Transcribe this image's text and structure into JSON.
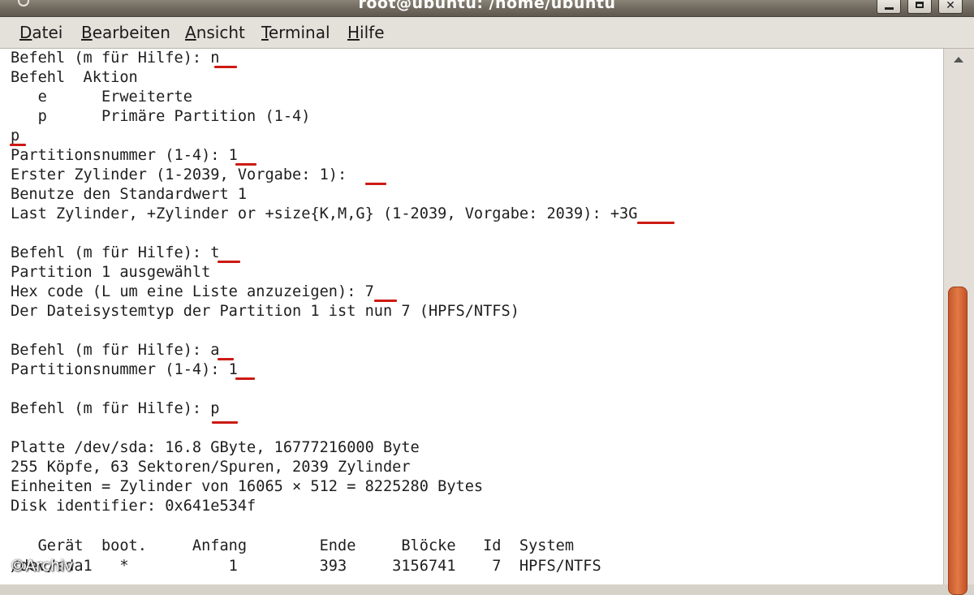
{
  "window": {
    "title": "root@ubuntu: /home/ubuntu",
    "minimize_glyph": "_",
    "maximize_glyph": "□",
    "close_glyph": "✕"
  },
  "menu": {
    "items": [
      "Datei",
      "Bearbeiten",
      "Ansicht",
      "Terminal",
      "Hilfe"
    ]
  },
  "terminal": {
    "lines": [
      "Befehl (m für Hilfe): n",
      "Befehl  Aktion",
      "   e      Erweiterte",
      "   p      Primäre Partition (1-4)",
      "p",
      "Partitionsnummer (1-4): 1",
      "Erster Zylinder (1-2039, Vorgabe: 1):",
      "Benutze den Standardwert 1",
      "Last Zylinder, +Zylinder or +size{K,M,G} (1-2039, Vorgabe: 2039): +3G",
      "",
      "Befehl (m für Hilfe): t",
      "Partition 1 ausgewählt",
      "Hex code (L um eine Liste anzuzeigen): 7",
      "Der Dateisystemtyp der Partition 1 ist nun 7 (HPFS/NTFS)",
      "",
      "Befehl (m für Hilfe): a",
      "Partitionsnummer (1-4): 1",
      "",
      "Befehl (m für Hilfe): p",
      "",
      "Platte /dev/sda: 16.8 GByte, 16777216000 Byte",
      "255 Köpfe, 63 Sektoren/Spuren, 2039 Zylinder",
      "Einheiten = Zylinder von 16065 × 512 = 8225280 Bytes",
      "Disk identifier: 0x641e534f",
      "",
      "   Gerät  boot.     Anfang        Ende     Blöcke   Id  System",
      "/dev/sda1   *           1         393     3156741    7  HPFS/NTFS"
    ]
  },
  "watermark": "©Archiv",
  "colors": {
    "input_underline": "#cc1a12",
    "scrollbar_thumb": "#e07a44",
    "terminal_bg": "#ffffff"
  }
}
